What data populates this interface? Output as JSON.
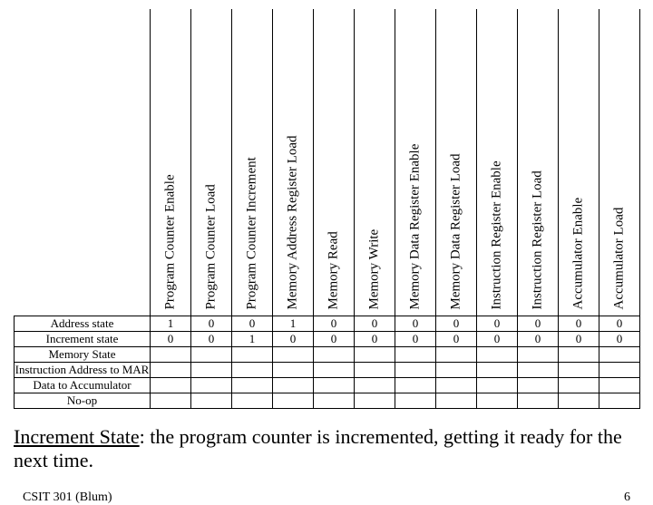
{
  "signals": [
    "Program Counter Enable",
    "Program Counter Load",
    "Program Counter Increment",
    "Memory Address Register Load",
    "Memory Read",
    "Memory Write",
    "Memory Data Register Enable",
    "Memory Data Register Load",
    "Instruction Register Enable",
    "Instruction Register Load",
    "Accumulator Enable",
    "Accumulator Load"
  ],
  "rows": [
    {
      "label": "Address state",
      "vals": [
        "1",
        "0",
        "0",
        "1",
        "0",
        "0",
        "0",
        "0",
        "0",
        "0",
        "0",
        "0"
      ]
    },
    {
      "label": "Increment state",
      "vals": [
        "0",
        "0",
        "1",
        "0",
        "0",
        "0",
        "0",
        "0",
        "0",
        "0",
        "0",
        "0"
      ]
    },
    {
      "label": "Memory State",
      "vals": [
        "",
        "",
        "",
        "",
        "",
        "",
        "",
        "",
        "",
        "",
        "",
        ""
      ]
    },
    {
      "label": "Instruction Address to MAR",
      "vals": [
        "",
        "",
        "",
        "",
        "",
        "",
        "",
        "",
        "",
        "",
        "",
        ""
      ]
    },
    {
      "label": "Data to Accumulator",
      "vals": [
        "",
        "",
        "",
        "",
        "",
        "",
        "",
        "",
        "",
        "",
        "",
        ""
      ]
    },
    {
      "label": "No-op",
      "vals": [
        "",
        "",
        "",
        "",
        "",
        "",
        "",
        "",
        "",
        "",
        "",
        ""
      ]
    }
  ],
  "caption_bold": "Increment State",
  "caption_rest": ": the program counter is incremented, getting it ready for the next time.",
  "footer_left": "CSIT 301 (Blum)",
  "footer_right": "6"
}
